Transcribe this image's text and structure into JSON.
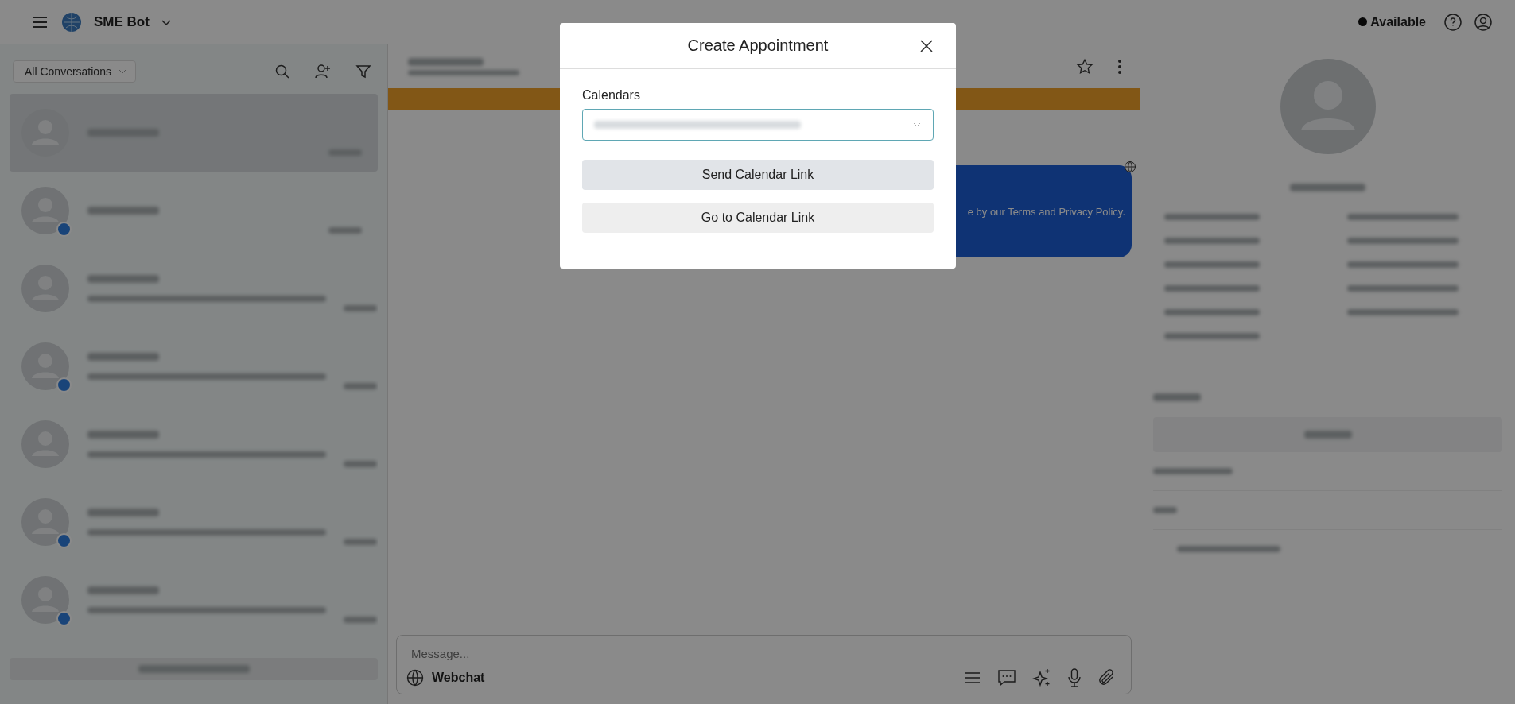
{
  "topbar": {
    "workspace": "SME Bot",
    "status": {
      "label": "Available",
      "on": true
    }
  },
  "sidebar": {
    "filter": "All Conversations",
    "conversations": [
      {
        "selected": true,
        "badge": false,
        "preview": false
      },
      {
        "selected": false,
        "badge": true,
        "preview": false
      },
      {
        "selected": false,
        "badge": false,
        "preview": true
      },
      {
        "selected": false,
        "badge": true,
        "preview": true
      },
      {
        "selected": false,
        "badge": false,
        "preview": true
      },
      {
        "selected": false,
        "badge": true,
        "preview": true
      },
      {
        "selected": false,
        "badge": true,
        "preview": true
      }
    ],
    "notifications_bar": true
  },
  "chat": {
    "banner": true,
    "message_tail": "e by our Terms and Privacy Policy.",
    "composer": {
      "placeholder": "Message...",
      "channel": "Webchat"
    }
  },
  "dialog": {
    "title": "Create Appointment",
    "field_label": "Calendars",
    "buttons": [
      {
        "label": "Send Calendar Link",
        "kind": "primary"
      },
      {
        "label": "Go to Calendar Link",
        "kind": "secondary"
      }
    ]
  }
}
